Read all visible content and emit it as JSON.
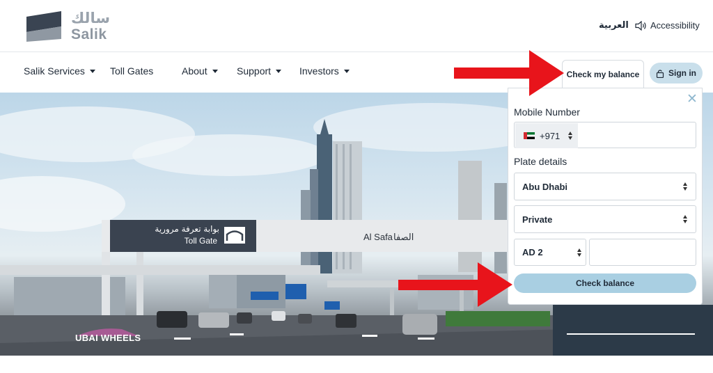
{
  "brand": {
    "logo_ar": "سالك",
    "logo_en": "Salik"
  },
  "header": {
    "language_link": "العربية",
    "accessibility_label": "Accessibility"
  },
  "nav": {
    "items": [
      {
        "label": "Salik Services",
        "has_dropdown": true
      },
      {
        "label": "Toll Gates",
        "has_dropdown": false
      },
      {
        "label": "About",
        "has_dropdown": true
      },
      {
        "label": "Support",
        "has_dropdown": true
      },
      {
        "label": "Investors",
        "has_dropdown": true
      }
    ],
    "check_balance_tab": "Check my balance",
    "signin_label": "Sign in"
  },
  "hero": {
    "gate_sign_ar": "بوابة تعرفة مرورية",
    "gate_sign_en": "Toll Gate",
    "gate_location_en": "Al Safa",
    "gate_location_ar": "الصفا",
    "watermark": "UBAI WHEELS"
  },
  "balance_form": {
    "mobile_label": "Mobile Number",
    "country_code": "+971",
    "mobile_value": "",
    "plate_label": "Plate details",
    "emirate_value": "Abu Dhabi",
    "plate_type_value": "Private",
    "plate_code_value": "AD 2",
    "plate_number_value": "",
    "submit_label": "Check balance"
  },
  "colors": {
    "accent_light_blue": "#a9cfe2",
    "signin_bg": "#c9dfeb",
    "arrow_red": "#e8141b",
    "text_dark": "#1f2a37"
  },
  "icons": {
    "close": "close-icon",
    "accessibility": "speaker-icon",
    "lock": "lock-icon",
    "flag": "uae-flag-icon"
  }
}
